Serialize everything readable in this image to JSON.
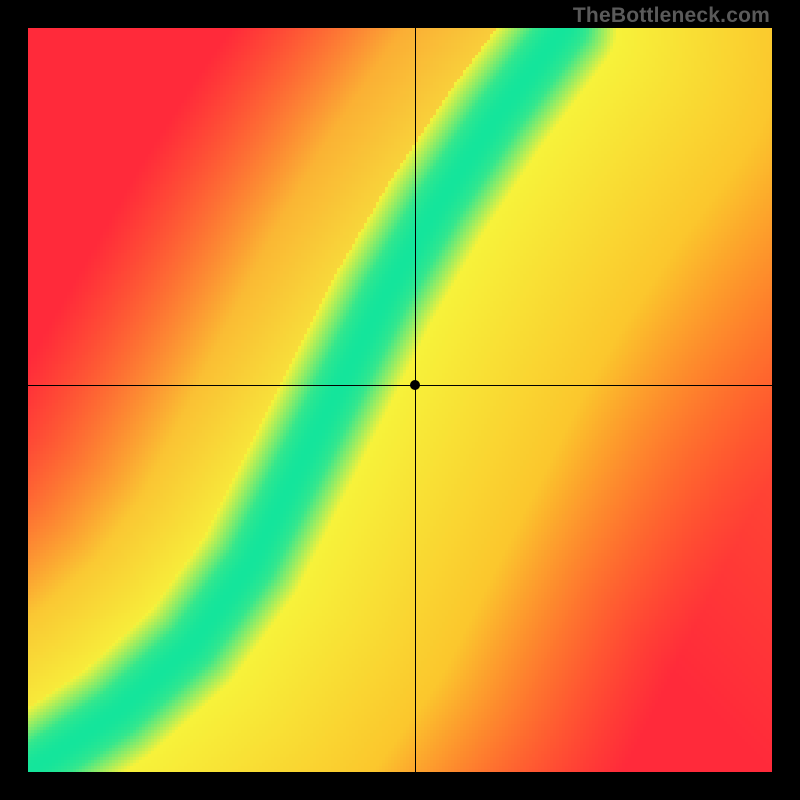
{
  "watermark": "TheBottleneck.com",
  "chart_data": {
    "type": "heatmap",
    "title": "",
    "xlabel": "",
    "ylabel": "",
    "xlim": [
      0,
      1
    ],
    "ylim": [
      0,
      1
    ],
    "grid": false,
    "legend": false,
    "crosshair": {
      "x": 0.52,
      "y": 0.52
    },
    "marker": {
      "x": 0.52,
      "y": 0.52
    },
    "optimal_band": {
      "description": "Green optimal curve with yellow falloff band on a red-orange-yellow background gradient",
      "control_points": [
        {
          "x": 0.0,
          "y": 0.0
        },
        {
          "x": 0.12,
          "y": 0.08
        },
        {
          "x": 0.22,
          "y": 0.17
        },
        {
          "x": 0.3,
          "y": 0.28
        },
        {
          "x": 0.36,
          "y": 0.4
        },
        {
          "x": 0.42,
          "y": 0.52
        },
        {
          "x": 0.48,
          "y": 0.64
        },
        {
          "x": 0.55,
          "y": 0.76
        },
        {
          "x": 0.63,
          "y": 0.88
        },
        {
          "x": 0.72,
          "y": 1.0
        }
      ],
      "band_half_width": 0.045
    },
    "color_stops": {
      "optimal": "#14e59b",
      "near": "#f7f23a",
      "mid": "#ff9a1f",
      "far": "#ff2a3a"
    }
  }
}
